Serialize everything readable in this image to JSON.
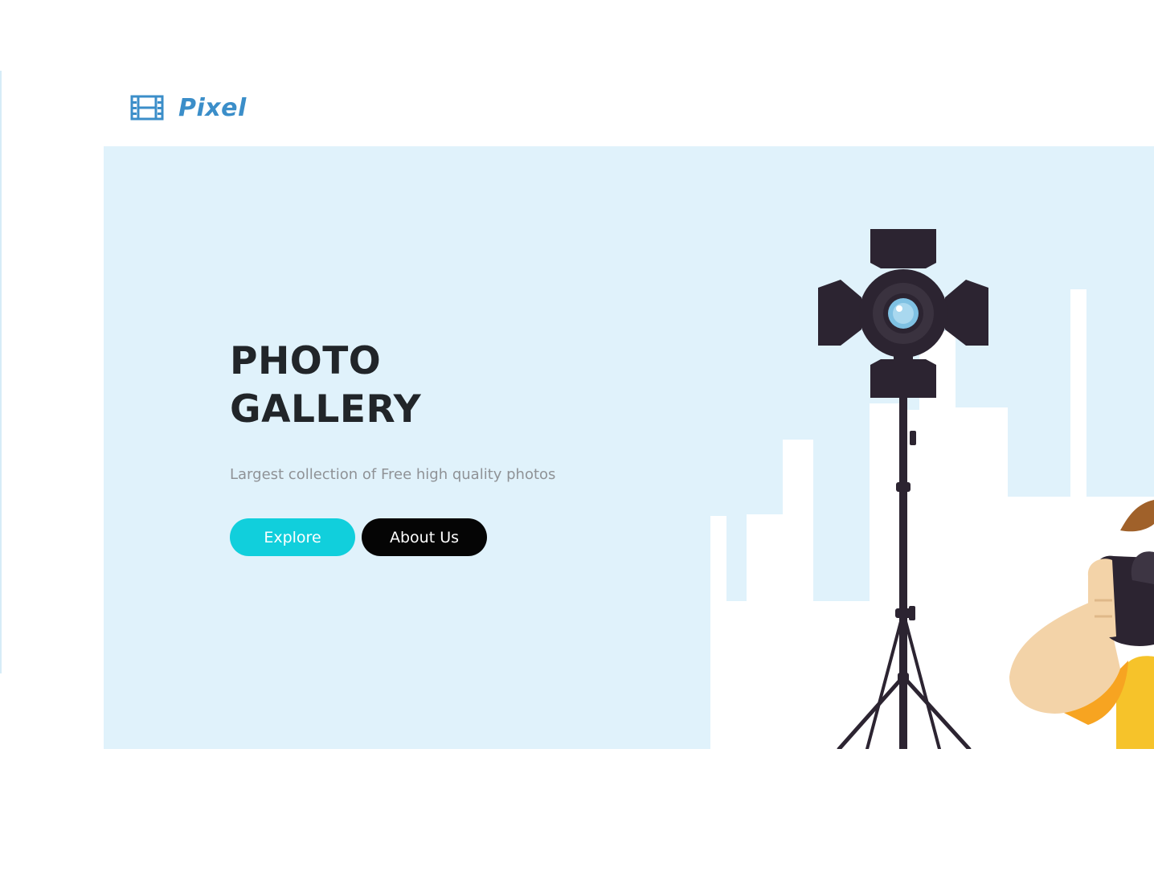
{
  "brand": {
    "name": "Pixel",
    "icon": "film-icon",
    "color": "#3b8ec9"
  },
  "hero": {
    "title_line1": "PHOTO",
    "title_line2": "GALLERY",
    "subtitle": "Largest collection of Free high quality photos",
    "background": "#e0f2fb",
    "buttons": {
      "explore": "Explore",
      "about": "About Us"
    },
    "illustration": "photographer-with-studio-light-illustration"
  },
  "colors": {
    "explore_button": "#11cfdc",
    "about_button": "#050505",
    "title": "#212529",
    "subtitle": "#8f9296"
  }
}
